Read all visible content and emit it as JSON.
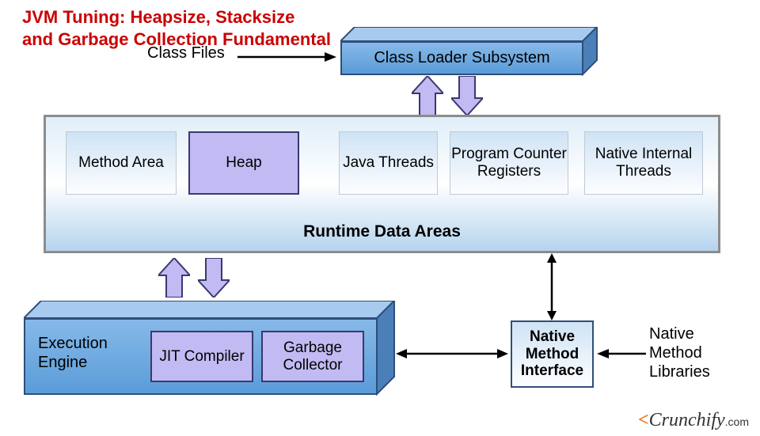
{
  "title_line1": "JVM Tuning: Heapsize, Stacksize",
  "title_line2": "and Garbage Collection Fundamental",
  "class_files_label": "Class Files",
  "class_loader": "Class Loader Subsystem",
  "rda": {
    "title": "Runtime Data Areas",
    "method_area": "Method Area",
    "heap": "Heap",
    "java_threads": "Java Threads",
    "pc_registers": "Program Counter Registers",
    "native_threads": "Native Internal Threads"
  },
  "exec_engine": {
    "label": "Execution Engine",
    "jit": "JIT Compiler",
    "gc": "Garbage Collector"
  },
  "nmi": "Native Method Interface",
  "nml": "Native Method Libraries",
  "logo": {
    "brand": "Crunchify",
    "suffix": ".com"
  }
}
